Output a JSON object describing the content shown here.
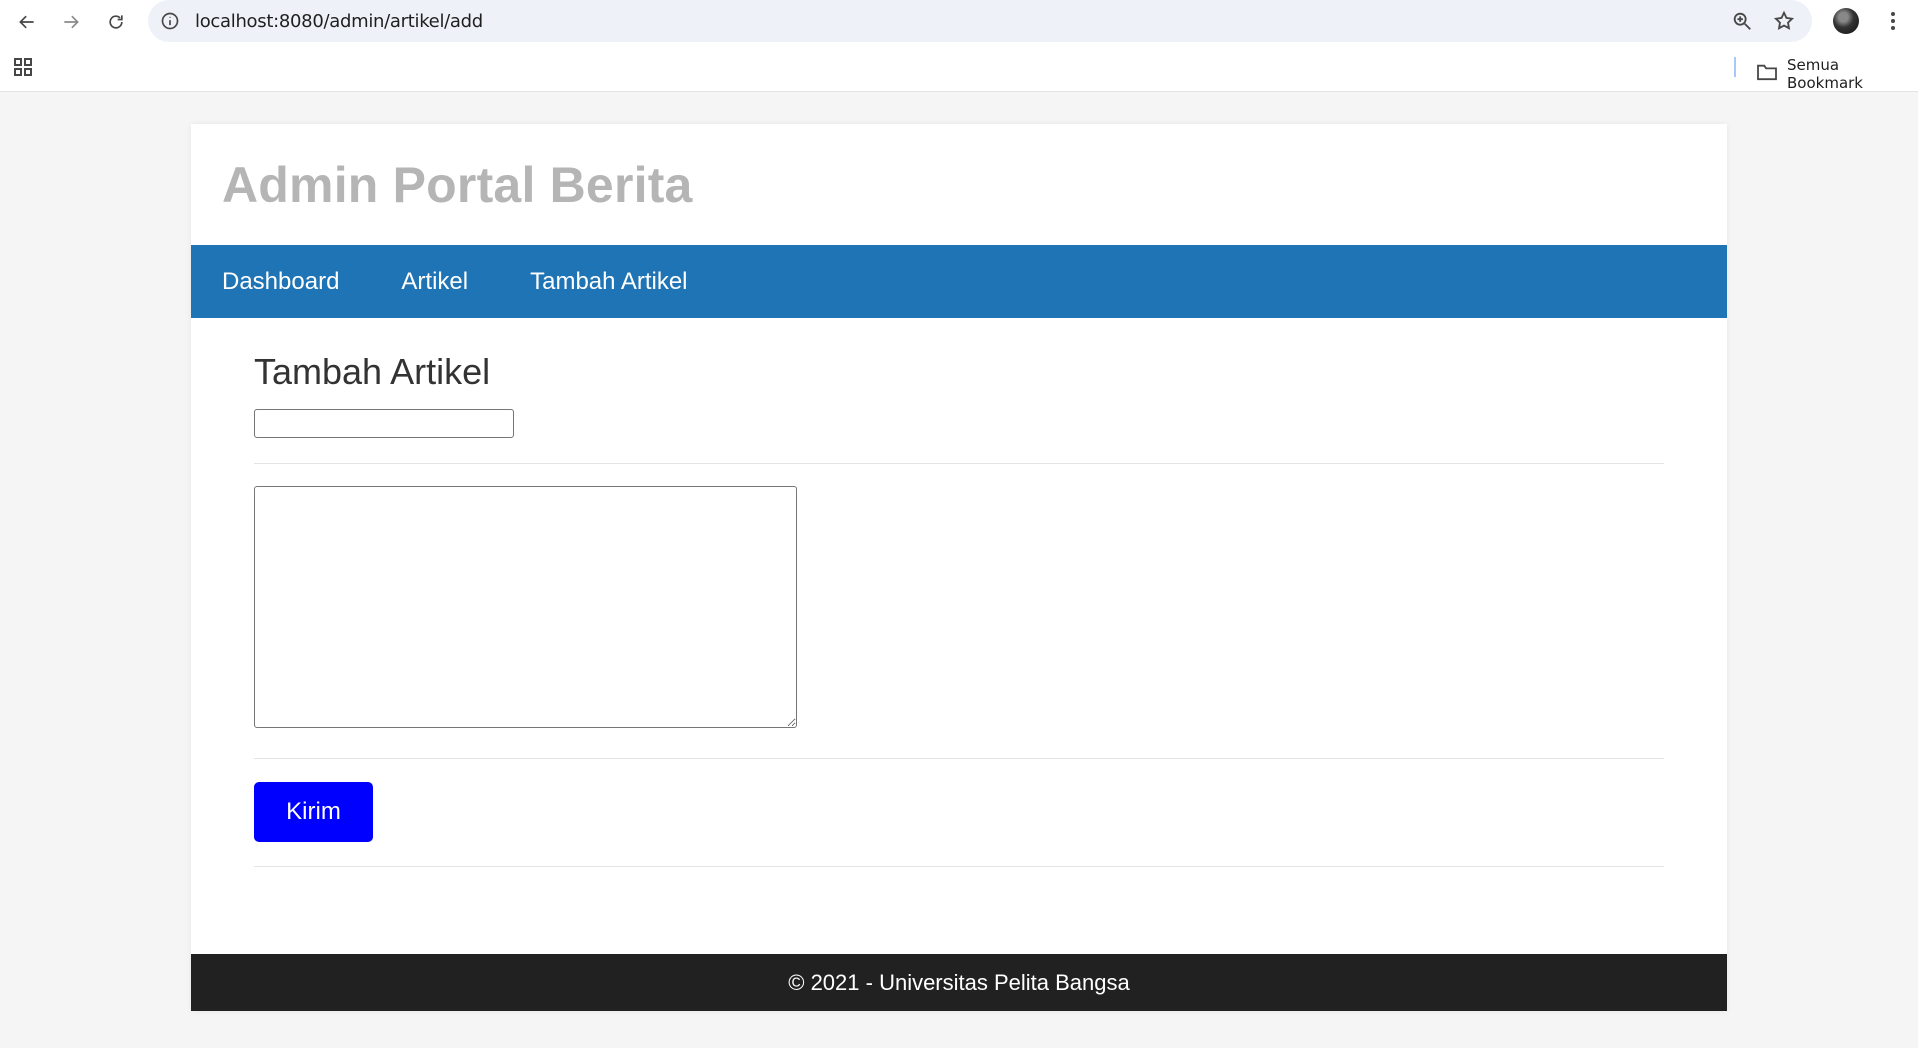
{
  "browser": {
    "url": "localhost:8080/admin/artikel/add",
    "bookmarks_folder_label": "Semua Bookmark",
    "icons": [
      "back-icon",
      "forward-icon",
      "reload-icon",
      "site-info-icon",
      "zoom-icon",
      "bookmark-star-icon",
      "profile-avatar",
      "menu-kebab-icon",
      "apps-grid-icon",
      "folder-icon"
    ]
  },
  "site": {
    "title": "Admin Portal Berita",
    "nav": [
      {
        "label": "Dashboard"
      },
      {
        "label": "Artikel"
      },
      {
        "label": "Tambah Artikel"
      }
    ],
    "nav_color": "#1f74b5"
  },
  "form": {
    "heading": "Tambah Artikel",
    "title_value": "",
    "body_value": "",
    "submit_label": "Kirim",
    "submit_color": "#0000ff"
  },
  "footer": {
    "text": "© 2021 - Universitas Pelita Bangsa"
  }
}
